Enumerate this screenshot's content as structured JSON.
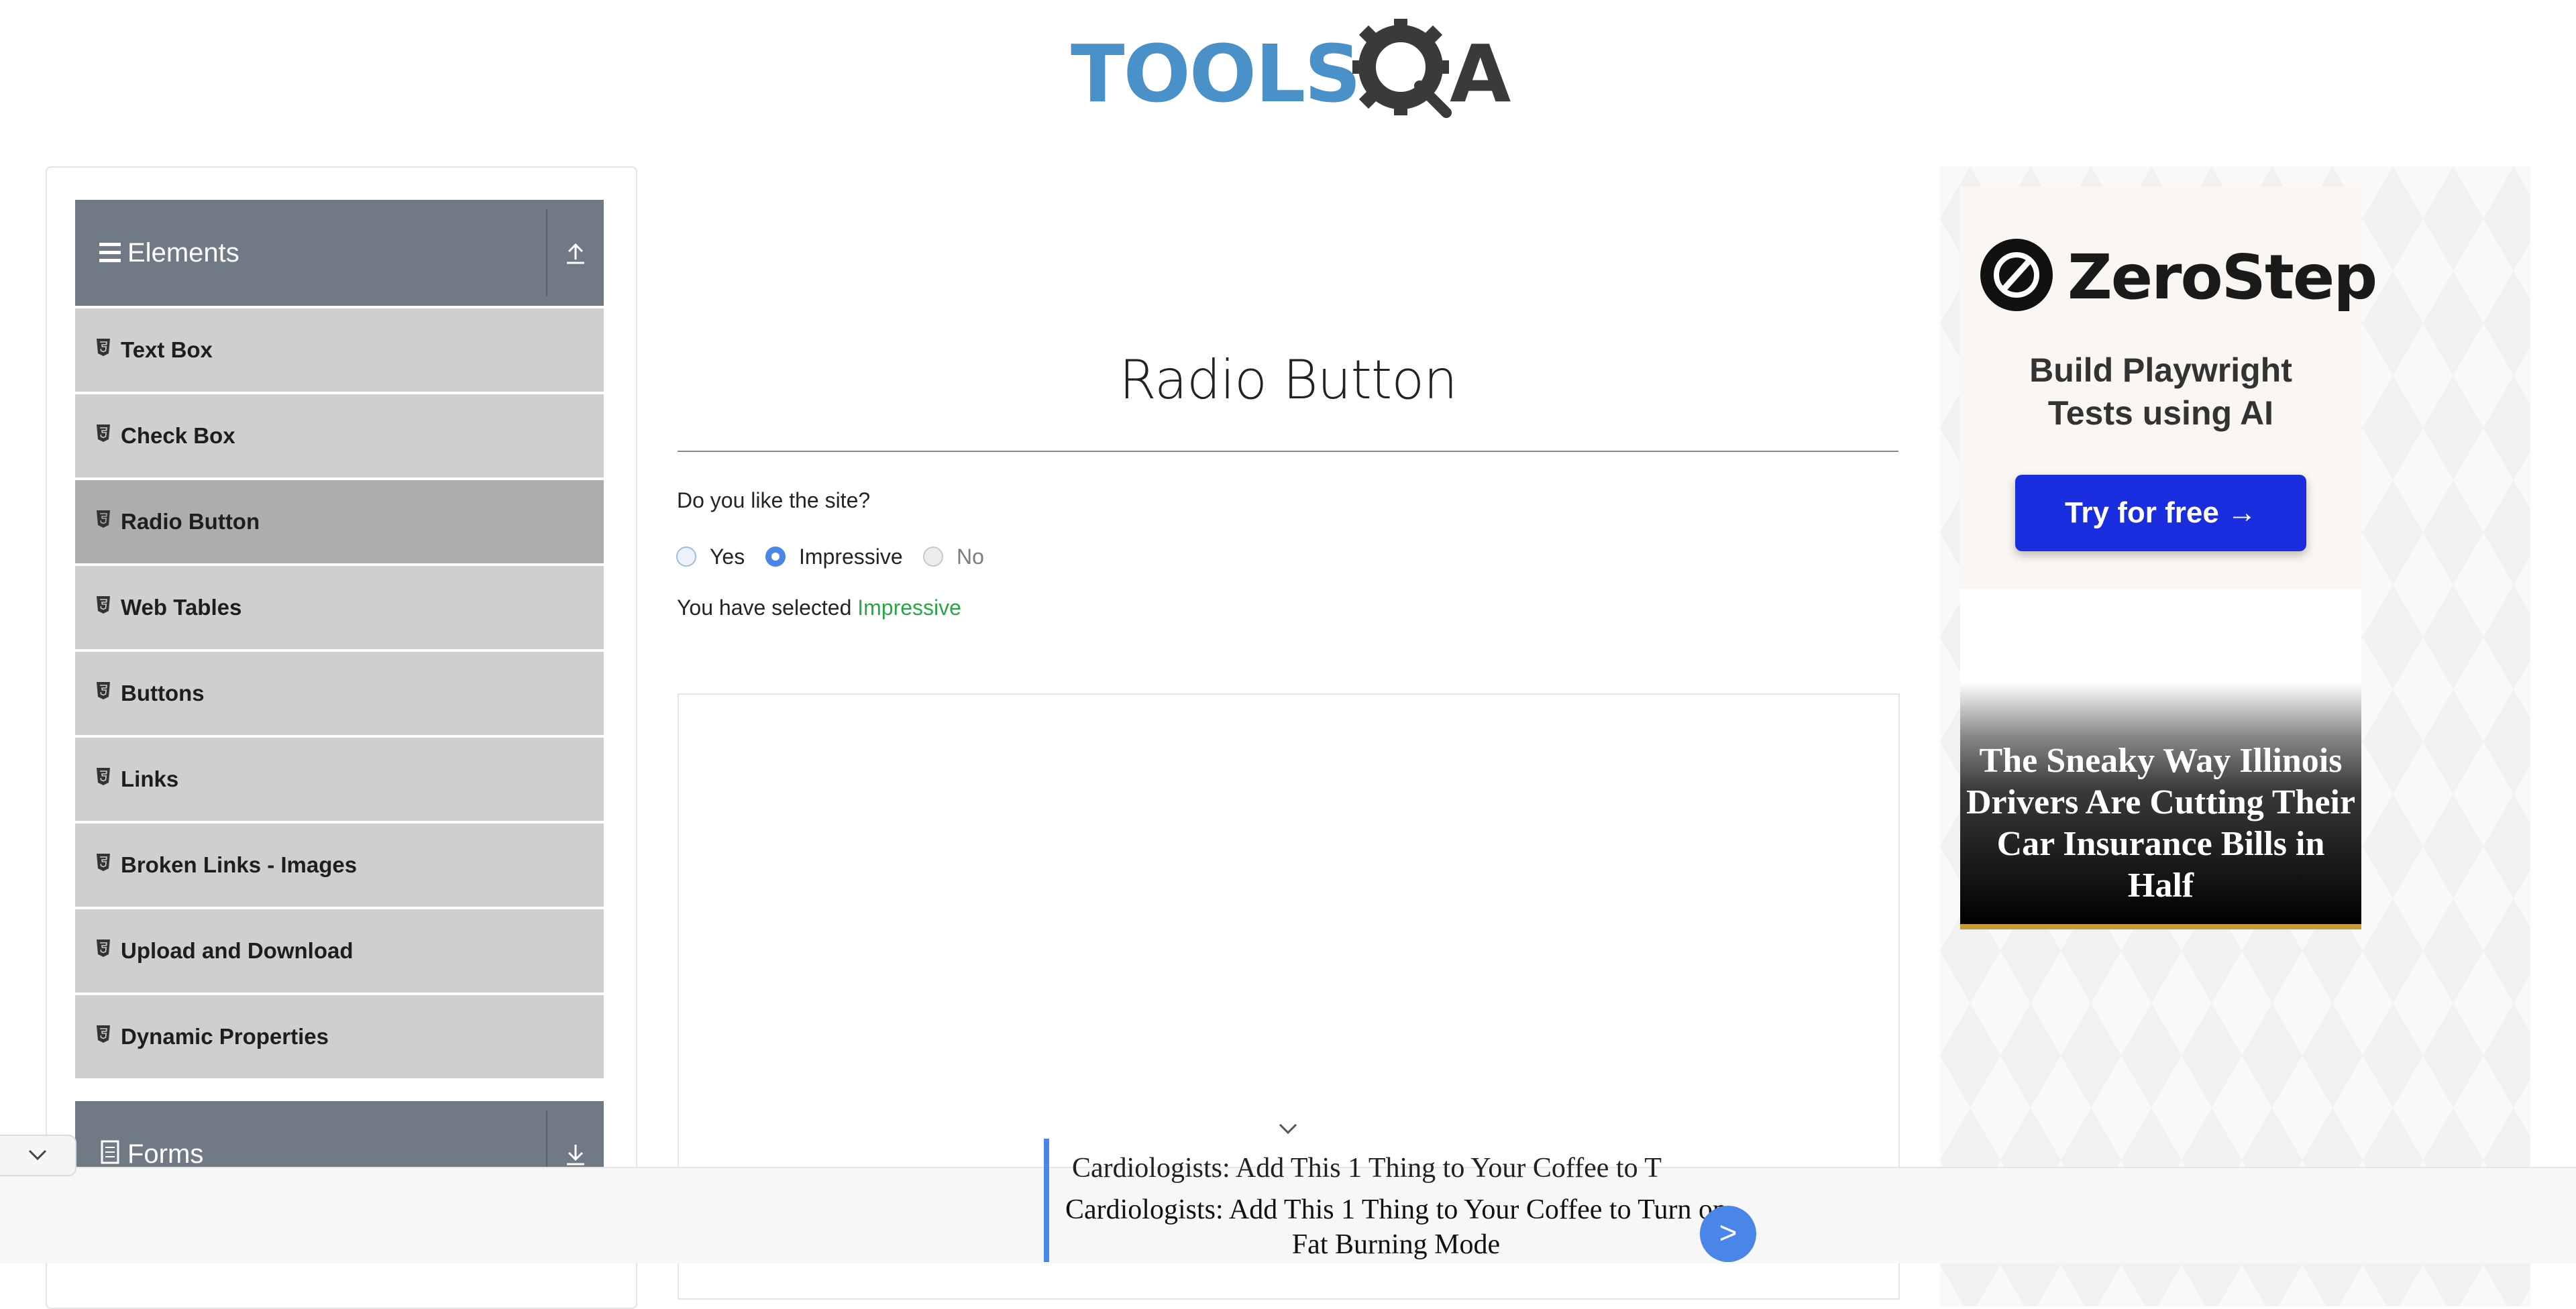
{
  "brand": {
    "logo_text_tools": "TOOLS",
    "logo_text_qa": "A"
  },
  "sidebar": {
    "group_elements": {
      "label": "Elements",
      "toggle_icon": "collapse-up-icon"
    },
    "items": [
      {
        "label": "Text Box"
      },
      {
        "label": "Check Box"
      },
      {
        "label": "Radio Button",
        "active": true
      },
      {
        "label": "Web Tables"
      },
      {
        "label": "Buttons"
      },
      {
        "label": "Links"
      },
      {
        "label": "Broken Links - Images"
      },
      {
        "label": "Upload and Download"
      },
      {
        "label": "Dynamic Properties"
      }
    ],
    "group_forms": {
      "label": "Forms",
      "toggle_icon": "expand-down-icon"
    }
  },
  "main": {
    "title": "Radio Button",
    "question": "Do you like the site?",
    "options": [
      {
        "label": "Yes",
        "checked": false,
        "disabled": false
      },
      {
        "label": "Impressive",
        "checked": true,
        "disabled": false
      },
      {
        "label": "No",
        "checked": false,
        "disabled": true
      }
    ],
    "result_prefix": "You have selected ",
    "result_value": "Impressive"
  },
  "right_ads": {
    "zerostep": {
      "brand": "ZeroStep",
      "tagline_line1": "Build Playwright",
      "tagline_line2": "Tests using AI",
      "cta": "Try for free →"
    },
    "illinois": {
      "headline": "The Sneaky Way Illinois Drivers Are Cutting Their Car Insurance Bills in Half"
    }
  },
  "bottom_ad": {
    "ghost_text": "Cardiologists: Add This 1 Thing to Your Coffee to T",
    "headline": "Cardiologists: Add This 1 Thing to Your Coffee to Turn on Fat Burning Mode",
    "go_label": ">"
  },
  "colors": {
    "accent": "#4a86e8",
    "success": "#28a745",
    "sidebar_header": "#707a84",
    "sidebar_item": "#cfcfcf",
    "sidebar_item_active": "#adadad",
    "cta_blue": "#1a2ee0"
  }
}
